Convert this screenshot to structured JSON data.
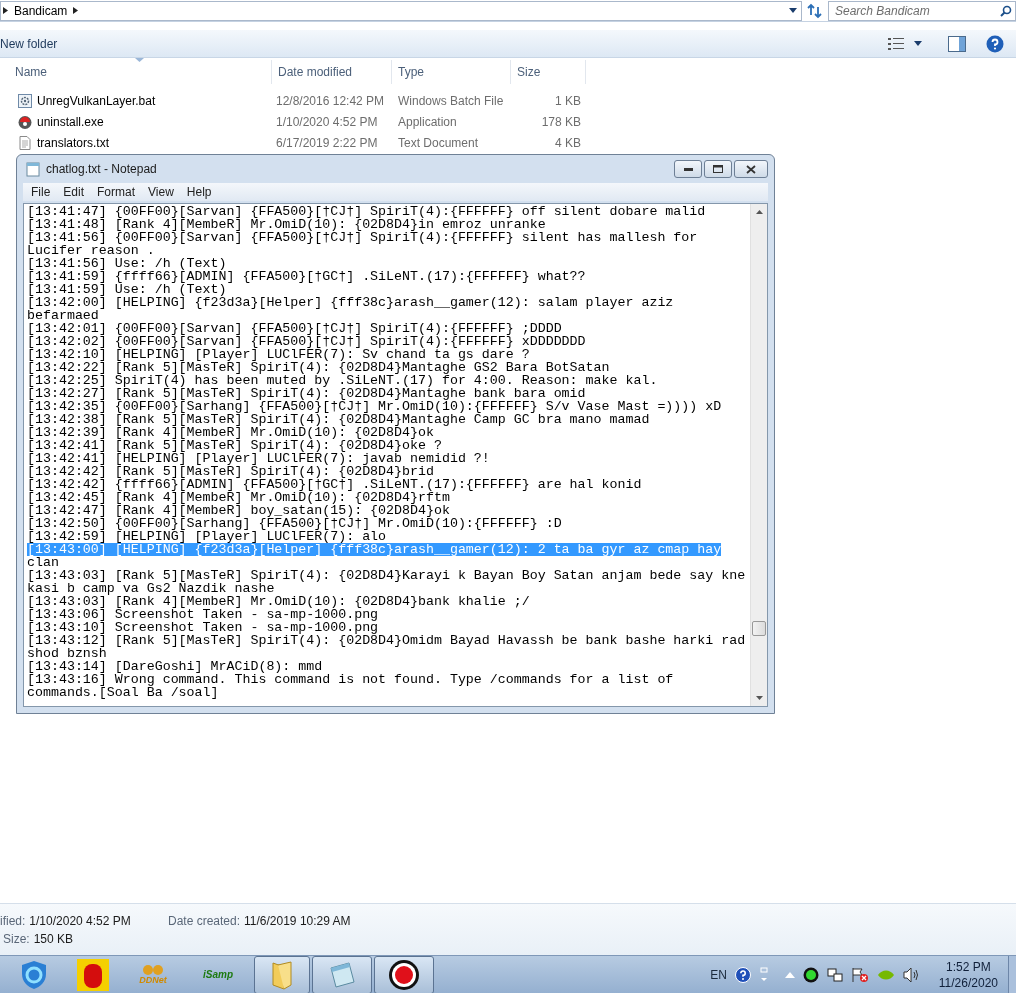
{
  "explorer": {
    "breadcrumb": [
      "Bandicam"
    ],
    "search": {
      "placeholder": "Search Bandicam"
    },
    "toolbar": {
      "new_folder": "New folder"
    },
    "columns": [
      "Name",
      "Date modified",
      "Type",
      "Size"
    ],
    "files": [
      {
        "name": "UnregVulkanLayer.bat",
        "date": "12/8/2016 12:42 PM",
        "type": "Windows Batch File",
        "size": "1 KB",
        "kind": "batch"
      },
      {
        "name": "uninstall.exe",
        "date": "1/10/2020 4:52 PM",
        "type": "Application",
        "size": "178 KB",
        "kind": "installer"
      },
      {
        "name": "translators.txt",
        "date": "6/17/2019 2:22 PM",
        "type": "Text Document",
        "size": "4 KB",
        "kind": "text"
      }
    ],
    "details": [
      {
        "label": "ified:",
        "value": "1/10/2020 4:52 PM"
      },
      {
        "label": "Date created:",
        "value": "11/6/2019 10:29 AM"
      },
      {
        "label": "Size:",
        "value": "150 KB"
      }
    ]
  },
  "notepad": {
    "title": "chatlog.txt - Notepad",
    "menu": [
      "File",
      "Edit",
      "Format",
      "View",
      "Help"
    ],
    "lines": [
      {
        "text": "[13:41:47] {00FF00}[Sarvan] {FFA500}[†CJ†] SpiriT(4):{FFFFFF} off silent dobare malid",
        "selected": false
      },
      {
        "text": "[13:41:48] [Rank 4][MembeR] Mr.OmiD(10): {02D8D4}in emroz unranke",
        "selected": false
      },
      {
        "text": "[13:41:56] {00FF00}[Sarvan] {FFA500}[†CJ†] SpiriT(4):{FFFFFF} silent has mallesh for Lucifer reason .",
        "selected": false
      },
      {
        "text": "[13:41:56] Use: /h (Text)",
        "selected": false
      },
      {
        "text": "[13:41:59] {ffff66}[ADMIN] {FFA500}[†GC†] .SiLeNT.(17):{FFFFFF} what??",
        "selected": false
      },
      {
        "text": "[13:41:59] Use: /h (Text)",
        "selected": false
      },
      {
        "text": "[13:42:00] [HELPING] {f23d3a}[Helper] {fff38c}arash__gamer(12): salam player aziz befarmaed",
        "selected": false
      },
      {
        "text": "[13:42:01] {00FF00}[Sarvan] {FFA500}[†CJ†] SpiriT(4):{FFFFFF} ;DDDD",
        "selected": false
      },
      {
        "text": "[13:42:02] {00FF00}[Sarvan] {FFA500}[†CJ†] SpiriT(4):{FFFFFF} xDDDDDDD",
        "selected": false
      },
      {
        "text": "[13:42:10] [HELPING] [Player] LUClFER(7): Sv chand ta gs dare ?",
        "selected": false
      },
      {
        "text": "[13:42:22] [Rank 5][MasTeR] SpiriT(4): {02D8D4}Mantaghe GS2 Bara BotSatan",
        "selected": false
      },
      {
        "text": "[13:42:25] SpiriT(4) has been muted by .SiLeNT.(17) for 4:00. Reason: make kal.",
        "selected": false
      },
      {
        "text": "[13:42:27] [Rank 5][MasTeR] SpiriT(4): {02D8D4}Mantaghe bank bara omid",
        "selected": false
      },
      {
        "text": "[13:42:35] {00FF00}[Sarhang] {FFA500}[†CJ†] Mr.OmiD(10):{FFFFFF} S/v Vase Mast =)))) xD",
        "selected": false
      },
      {
        "text": "[13:42:38] [Rank 5][MasTeR] SpiriT(4): {02D8D4}Mantaghe Camp GC bra mano mamad",
        "selected": false
      },
      {
        "text": "[13:42:39] [Rank 4][MembeR] Mr.OmiD(10): {02D8D4}ok",
        "selected": false
      },
      {
        "text": "[13:42:41] [Rank 5][MasTeR] SpiriT(4): {02D8D4}oke ?",
        "selected": false
      },
      {
        "text": "[13:42:41] [HELPING] [Player] LUClFER(7): javab nemidid ?!",
        "selected": false
      },
      {
        "text": "[13:42:42] [Rank 5][MasTeR] SpiriT(4): {02D8D4}brid",
        "selected": false
      },
      {
        "text": "[13:42:42] {ffff66}[ADMIN] {FFA500}[†GC†] .SiLeNT.(17):{FFFFFF} are hal konid",
        "selected": false
      },
      {
        "text": "[13:42:45] [Rank 4][MembeR] Mr.OmiD(10): {02D8D4}rftm",
        "selected": false
      },
      {
        "text": "[13:42:47] [Rank 4][MembeR] boy_satan(15): {02D8D4}ok",
        "selected": false
      },
      {
        "text": "[13:42:50] {00FF00}[Sarhang] {FFA500}[†CJ†] Mr.OmiD(10):{FFFFFF} :D",
        "selected": false
      },
      {
        "text": "[13:42:59] [HELPING] [Player] LUClFER(7): alo",
        "selected": false
      },
      {
        "text": "[13:43:00] [HELPING] {f23d3a}[Helper] {fff38c}arash__gamer(12): 2 ta ba gyr az cmap hay",
        "selected": true
      },
      {
        "text": "clan",
        "selected": false
      },
      {
        "text": "[13:43:03] [Rank 5][MasTeR] SpiriT(4): {02D8D4}Karayi k Bayan Boy Satan anjam bede say kne kasi b camp va Gs2 Nazdik nashe",
        "selected": false
      },
      {
        "text": "[13:43:03] [Rank 4][MembeR] Mr.OmiD(10): {02D8D4}bank khalie ;/",
        "selected": false
      },
      {
        "text": "[13:43:06] Screenshot Taken - sa-mp-1000.png",
        "selected": false
      },
      {
        "text": "[13:43:10] Screenshot Taken - sa-mp-1000.png",
        "selected": false
      },
      {
        "text": "[13:43:12] [Rank 5][MasTeR] SpiriT(4): {02D8D4}Omidm Bayad Havassh be bank bashe harki rad shod bznsh",
        "selected": false
      },
      {
        "text": "[13:43:14] [DareGoshi] MrACiD(8): mmd",
        "selected": false
      },
      {
        "text": "[13:43:16] Wrong command. This command is not found. Type /commands for a list of commands.[Soal Ba /soal]",
        "selected": false
      }
    ]
  },
  "taskbar": {
    "apps": [
      {
        "kind": "browser",
        "open": false
      },
      {
        "kind": "game",
        "open": false
      },
      {
        "kind": "ddnet",
        "label": "DDNet",
        "open": false
      },
      {
        "kind": "samp",
        "label": "iSamp",
        "open": false
      },
      {
        "kind": "folder",
        "open": true
      },
      {
        "kind": "notepad",
        "open": true
      },
      {
        "kind": "recorder",
        "open": true
      }
    ],
    "language": "EN",
    "clock": {
      "time": "1:52 PM",
      "date": "11/26/2020"
    }
  }
}
